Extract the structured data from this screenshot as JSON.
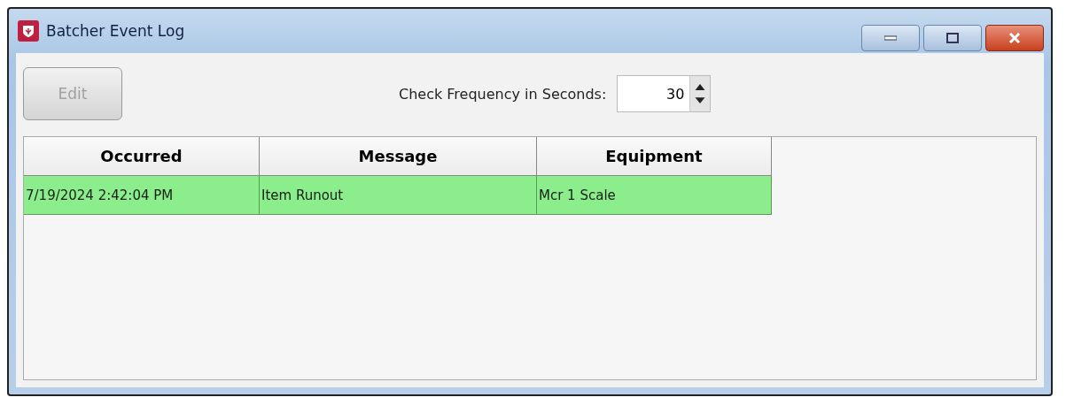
{
  "window": {
    "title": "Batcher Event Log"
  },
  "edit_button": {
    "label": "Edit",
    "disabled": true
  },
  "frequency": {
    "label": "Check Frequency in Seconds:",
    "value": "30"
  },
  "table": {
    "columns": [
      "Occurred",
      "Message",
      "Equipment"
    ],
    "rows": [
      {
        "cells": [
          "7/19/2024 2:42:04 PM",
          "Item Runout",
          "Mcr 1 Scale"
        ],
        "color": "#8ced8c"
      }
    ]
  }
}
